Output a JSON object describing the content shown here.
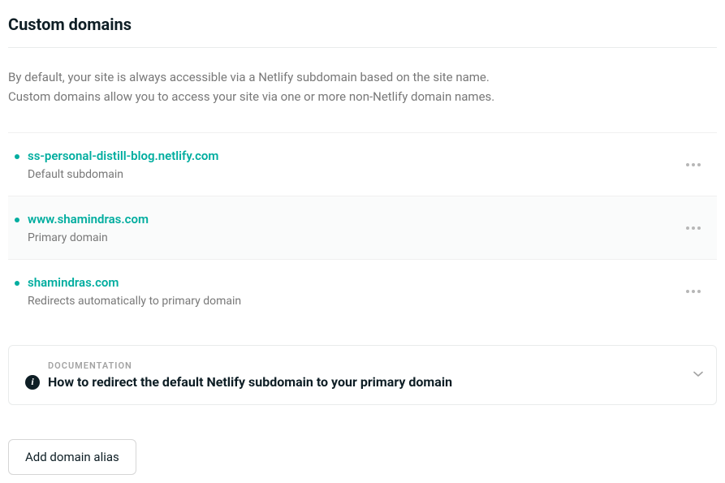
{
  "section": {
    "title": "Custom domains",
    "description_line1": "By default, your site is always accessible via a Netlify subdomain based on the site name.",
    "description_line2": "Custom domains allow you to access your site via one or more non-Netlify domain names."
  },
  "domains": [
    {
      "name": "ss-personal-distill-blog.netlify.com",
      "sublabel": "Default subdomain",
      "highlighted": false
    },
    {
      "name": "www.shamindras.com",
      "sublabel": "Primary domain",
      "highlighted": true
    },
    {
      "name": "shamindras.com",
      "sublabel": "Redirects automatically to primary domain",
      "highlighted": false
    }
  ],
  "documentation": {
    "label": "DOCUMENTATION",
    "title": "How to redirect the default Netlify subdomain to your primary domain"
  },
  "actions": {
    "add_domain_alias": "Add domain alias"
  }
}
